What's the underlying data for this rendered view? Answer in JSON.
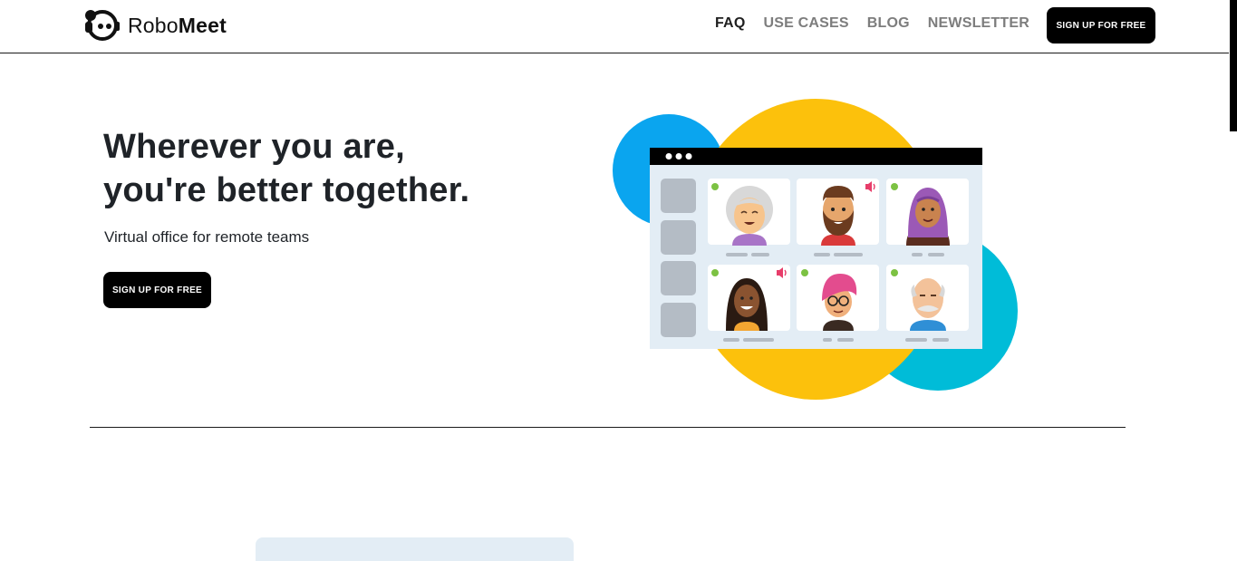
{
  "brand": {
    "name_prefix": "Robo",
    "name_bold": "Meet",
    "icon": "robot-head-icon"
  },
  "nav": {
    "items": [
      {
        "label": "FAQ",
        "active": true
      },
      {
        "label": "USE CASES",
        "active": false
      },
      {
        "label": "BLOG",
        "active": false
      },
      {
        "label": "NEWSLETTER",
        "active": false
      }
    ],
    "cta_label": "SIGN UP FOR FREE"
  },
  "hero": {
    "title_line1": "Wherever you are,",
    "title_line2": "you're better together.",
    "subtitle": "Virtual office for remote teams",
    "cta_label": "SIGN UP FOR FREE"
  },
  "illustration": {
    "icon": "video-call-illustration",
    "participants": [
      {
        "avatar": "elderly-woman-avatar",
        "online": true,
        "speaking": false
      },
      {
        "avatar": "bearded-man-avatar",
        "online": false,
        "speaking": true
      },
      {
        "avatar": "hijab-woman-avatar",
        "online": true,
        "speaking": false
      },
      {
        "avatar": "long-hair-woman-avatar",
        "online": true,
        "speaking": true
      },
      {
        "avatar": "pink-hair-glasses-avatar",
        "online": true,
        "speaking": false
      },
      {
        "avatar": "bald-elderly-man-avatar",
        "online": true,
        "speaking": false
      }
    ]
  },
  "colors": {
    "accent_black": "#000000",
    "blob_blue": "#0aa5ef",
    "blob_yellow": "#fcc10c",
    "blob_teal": "#00bcd8",
    "panel_bg": "#e3edf5",
    "online_green": "#7cc243",
    "speaker_pink": "#e73d6a"
  }
}
